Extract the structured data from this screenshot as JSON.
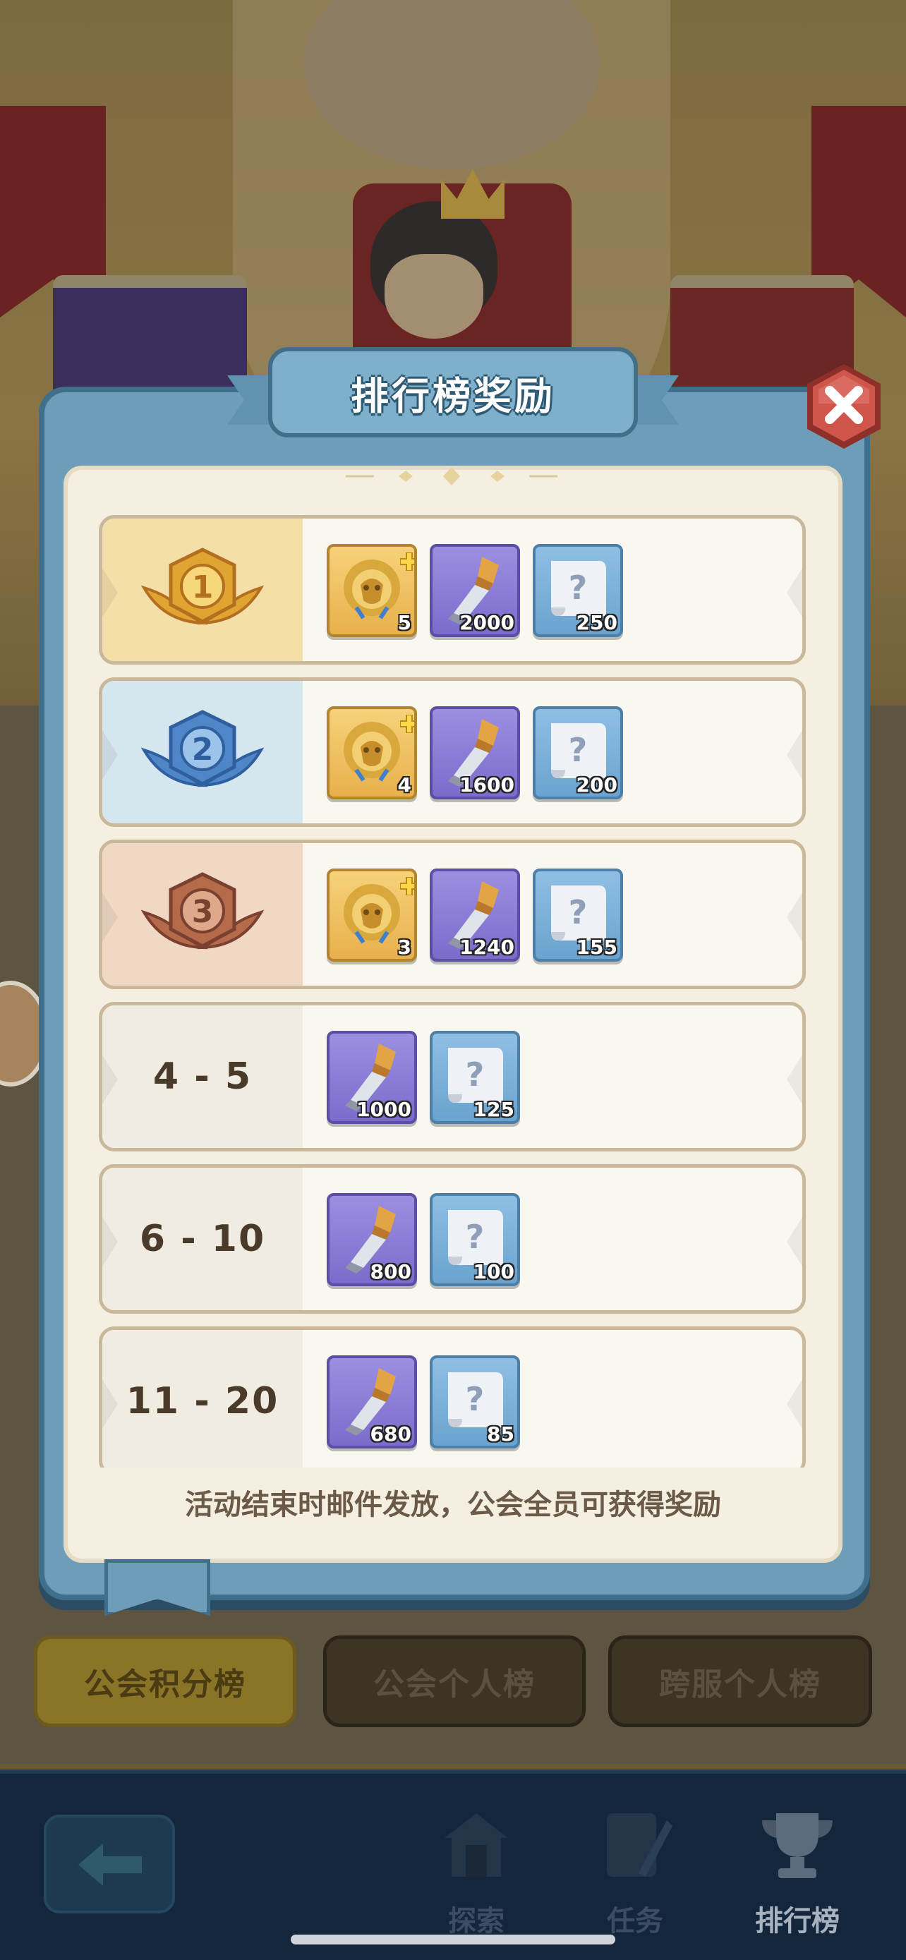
{
  "panel": {
    "title": "排行榜奖励",
    "footer_note": "活动结束时邮件发放，公会全员可获得奖励"
  },
  "rows": [
    {
      "rank_type": "medal",
      "medal": "gold",
      "rank": "1",
      "rewards": [
        {
          "icon": "lion-chest-icon",
          "qty": "5"
        },
        {
          "icon": "chisel-icon",
          "qty": "2000"
        },
        {
          "icon": "mystery-scroll-icon",
          "qty": "250"
        }
      ]
    },
    {
      "rank_type": "medal",
      "medal": "silver",
      "rank": "2",
      "rewards": [
        {
          "icon": "lion-chest-icon",
          "qty": "4"
        },
        {
          "icon": "chisel-icon",
          "qty": "1600"
        },
        {
          "icon": "mystery-scroll-icon",
          "qty": "200"
        }
      ]
    },
    {
      "rank_type": "medal",
      "medal": "bronze",
      "rank": "3",
      "rewards": [
        {
          "icon": "lion-chest-icon",
          "qty": "3"
        },
        {
          "icon": "chisel-icon",
          "qty": "1240"
        },
        {
          "icon": "mystery-scroll-icon",
          "qty": "155"
        }
      ]
    },
    {
      "rank_type": "range",
      "rank": "4 - 5",
      "rewards": [
        {
          "icon": "chisel-icon",
          "qty": "1000"
        },
        {
          "icon": "mystery-scroll-icon",
          "qty": "125"
        }
      ]
    },
    {
      "rank_type": "range",
      "rank": "6 - 10",
      "rewards": [
        {
          "icon": "chisel-icon",
          "qty": "800"
        },
        {
          "icon": "mystery-scroll-icon",
          "qty": "100"
        }
      ]
    },
    {
      "rank_type": "range",
      "rank": "11 - 20",
      "rewards": [
        {
          "icon": "chisel-icon",
          "qty": "680"
        },
        {
          "icon": "mystery-scroll-icon",
          "qty": "85"
        }
      ]
    }
  ],
  "tabs": [
    "公会积分榜",
    "公会个人榜",
    "跨服个人榜"
  ],
  "bottom_nav": {
    "back_icon": "back-arrow-icon",
    "items": [
      {
        "label": "探索",
        "icon": "explore-building-icon"
      },
      {
        "label": "任务",
        "icon": "quest-book-icon"
      },
      {
        "label": "排行榜",
        "icon": "trophy-icon"
      }
    ]
  },
  "colors": {
    "gold_medal": "#e0a531",
    "silver_medal": "#4f86c8",
    "bronze_medal": "#b56a4a",
    "panel_blue": "#6d9db8",
    "close_red": "#d0564b"
  }
}
